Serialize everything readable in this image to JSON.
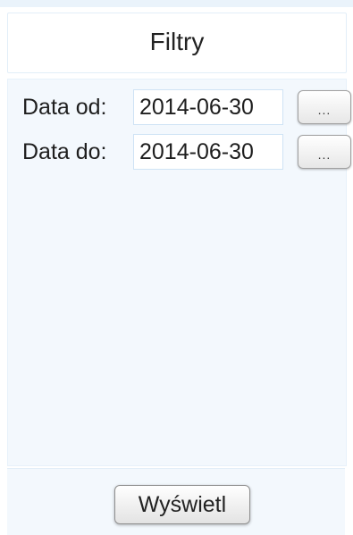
{
  "panel": {
    "title": "Filtry"
  },
  "filters": {
    "date_from": {
      "label": "Data od:",
      "value": "2014-06-30",
      "picker_label": "..."
    },
    "date_to": {
      "label": "Data do:",
      "value": "2014-06-30",
      "picker_label": "..."
    }
  },
  "actions": {
    "show_label": "Wyświetl"
  }
}
